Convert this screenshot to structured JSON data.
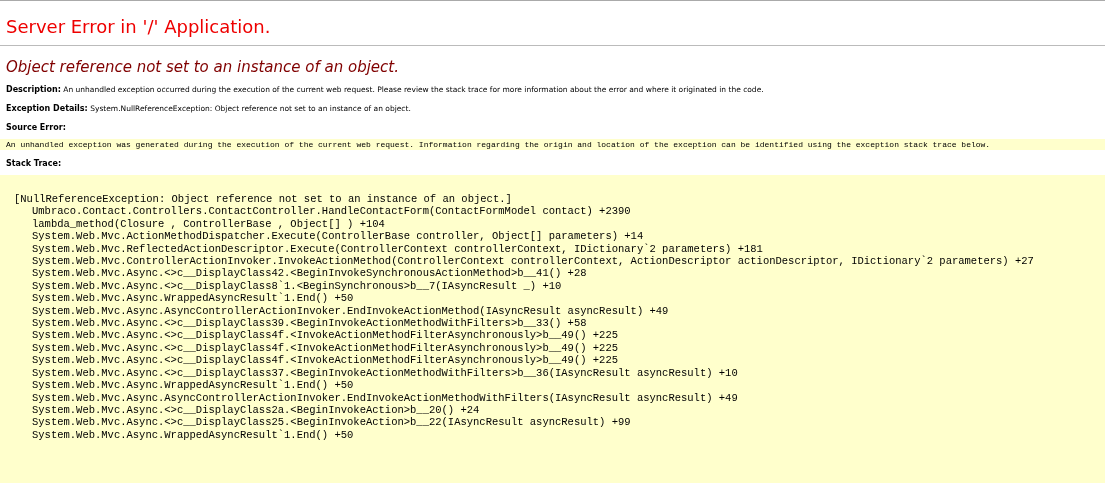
{
  "title": "Server Error in '/' Application.",
  "error_message": "Object reference not set to an instance of an object.",
  "description": {
    "label": "Description:",
    "text": "An unhandled exception occurred during the execution of the current web request. Please review the stack trace for more information about the error and where it originated in the code."
  },
  "exception_details": {
    "label": "Exception Details:",
    "text": "System.NullReferenceException: Object reference not set to an instance of an object."
  },
  "source_error": {
    "label": "Source Error:",
    "text": "An unhandled exception was generated during the execution of the current web request. Information regarding the origin and location of the exception can be identified using the exception stack trace below."
  },
  "stack_trace": {
    "label": "Stack Trace:",
    "exception": "[NullReferenceException: Object reference not set to an instance of an object.]",
    "frames": [
      "Umbraco.Contact.Controllers.ContactController.HandleContactForm(ContactFormModel contact) +2390",
      "lambda_method(Closure , ControllerBase , Object[] ) +104",
      "System.Web.Mvc.ActionMethodDispatcher.Execute(ControllerBase controller, Object[] parameters) +14",
      "System.Web.Mvc.ReflectedActionDescriptor.Execute(ControllerContext controllerContext, IDictionary`2 parameters) +181",
      "System.Web.Mvc.ControllerActionInvoker.InvokeActionMethod(ControllerContext controllerContext, ActionDescriptor actionDescriptor, IDictionary`2 parameters) +27",
      "System.Web.Mvc.Async.<>c__DisplayClass42.<BeginInvokeSynchronousActionMethod>b__41() +28",
      "System.Web.Mvc.Async.<>c__DisplayClass8`1.<BeginSynchronous>b__7(IAsyncResult _) +10",
      "System.Web.Mvc.Async.WrappedAsyncResult`1.End() +50",
      "System.Web.Mvc.Async.AsyncControllerActionInvoker.EndInvokeActionMethod(IAsyncResult asyncResult) +49",
      "System.Web.Mvc.Async.<>c__DisplayClass39.<BeginInvokeActionMethodWithFilters>b__33() +58",
      "System.Web.Mvc.Async.<>c__DisplayClass4f.<InvokeActionMethodFilterAsynchronously>b__49() +225",
      "System.Web.Mvc.Async.<>c__DisplayClass4f.<InvokeActionMethodFilterAsynchronously>b__49() +225",
      "System.Web.Mvc.Async.<>c__DisplayClass4f.<InvokeActionMethodFilterAsynchronously>b__49() +225",
      "System.Web.Mvc.Async.<>c__DisplayClass37.<BeginInvokeActionMethodWithFilters>b__36(IAsyncResult asyncResult) +10",
      "System.Web.Mvc.Async.WrappedAsyncResult`1.End() +50",
      "System.Web.Mvc.Async.AsyncControllerActionInvoker.EndInvokeActionMethodWithFilters(IAsyncResult asyncResult) +49",
      "System.Web.Mvc.Async.<>c__DisplayClass2a.<BeginInvokeAction>b__20() +24",
      "System.Web.Mvc.Async.<>c__DisplayClass25.<BeginInvokeAction>b__22(IAsyncResult asyncResult) +99",
      "System.Web.Mvc.Async.WrappedAsyncResult`1.End() +50"
    ]
  }
}
